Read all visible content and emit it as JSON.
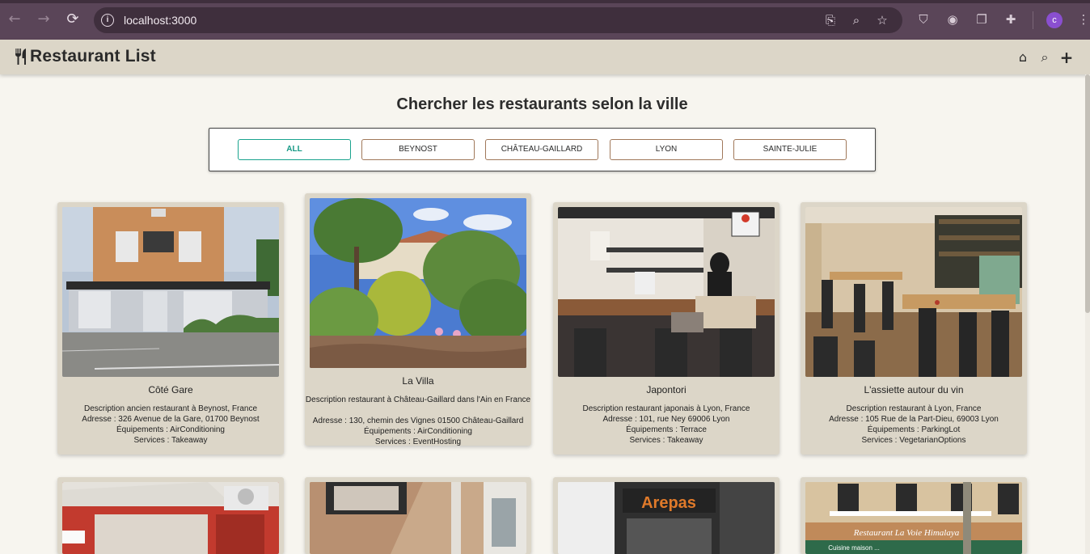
{
  "browser": {
    "url": "localhost:3000",
    "profile_initial": "c",
    "back_icon": "←",
    "forward_icon": "→",
    "reload_icon": "⟳"
  },
  "header": {
    "title": "Restaurant List",
    "logo_icon": "utensils-icon"
  },
  "main": {
    "title": "Chercher les restaurants selon la ville",
    "filters": [
      {
        "label": "ALL",
        "active": true
      },
      {
        "label": "BEYNOST",
        "active": false
      },
      {
        "label": "CHÂTEAU-GAILLARD",
        "active": false
      },
      {
        "label": "LYON",
        "active": false
      },
      {
        "label": "SAINTE-JULIE",
        "active": false
      }
    ],
    "restaurants": [
      {
        "name": "Côté Gare",
        "description": "Description ancien restaurant à Beynost, France",
        "address": "Adresse : 326 Avenue de la Gare, 01700 Beynost",
        "equipment": "Équipements : AirConditioning",
        "services": "Services : Takeaway"
      },
      {
        "name": "La Villa",
        "description": "Description restaurant à Château-Gaillard dans l'Ain en France",
        "address": "Adresse : 130, chemin des Vignes 01500 Château-Gaillard",
        "equipment": "Équipements : AirConditioning",
        "services": "Services : EventHosting"
      },
      {
        "name": "Japontori",
        "description": "Description restaurant japonais à Lyon, France",
        "address": "Adresse : 101, rue Ney 69006 Lyon",
        "equipment": "Équipements : Terrace",
        "services": "Services : Takeaway"
      },
      {
        "name": "L'assiette autour du vin",
        "description": "Description restaurant à Lyon, France",
        "address": "Adresse : 105 Rue de la Part-Dieu, 69003 Lyon",
        "equipment": "Équipements : ParkingLot",
        "services": "Services : VegetarianOptions"
      }
    ],
    "second_row_signs": {
      "sign_3": "Arepas",
      "sign_4": "Restaurant La Voie Himalaya",
      "sign_4_sub": "Cuisine maison ..."
    }
  },
  "colors": {
    "accent": "#1aa38e",
    "card_bg": "#dcd6c8",
    "page_bg": "#f7f5ef",
    "browser_bg": "#5a4558"
  }
}
